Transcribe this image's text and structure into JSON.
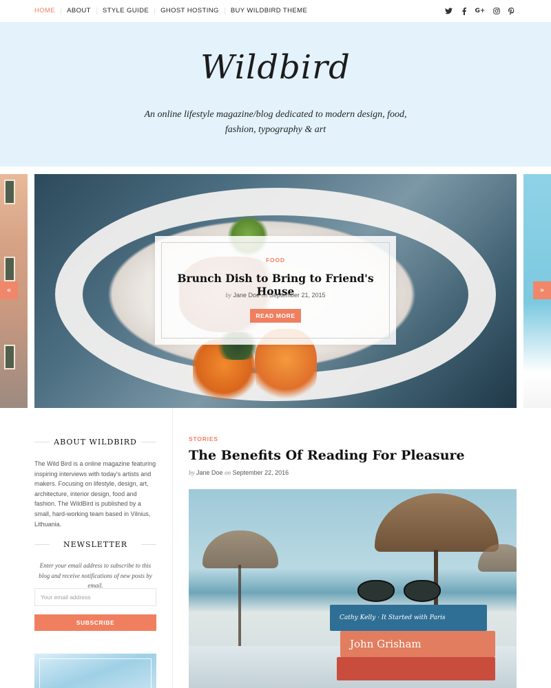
{
  "nav": {
    "items": [
      "Home",
      "About",
      "Style Guide",
      "Ghost Hosting",
      "Buy WildBird Theme"
    ],
    "active_index": 0
  },
  "socials": [
    "twitter-icon",
    "facebook-icon",
    "google-plus-icon",
    "instagram-icon",
    "pinterest-icon"
  ],
  "header": {
    "logo": "Wildbird",
    "tagline": "An online lifestyle magazine/blog dedicated to modern design, food, fashion, typography & art"
  },
  "slider": {
    "category": "Food",
    "title": "Brunch Dish to Bring to Friend's House",
    "by": "by",
    "author": "Jane Doe",
    "on": "on",
    "date": "September 21, 2015",
    "button": "Read More",
    "prev_icon": "«",
    "next_icon": "»"
  },
  "sidebar": {
    "about_title": "About Wildbird",
    "about_text": "The Wild Bird is a online magazine featuring inspiring interviews with today's artists and makers. Focusing on lifestyle, design, art, architecture, interior design, food and fashion. The WildBird is published by a small, hard-working team based in Vilnius, Lithuania.",
    "newsletter_title": "Newsletter",
    "newsletter_text": "Enter your email address to subscribe to this blog and receive notifications of new posts by email.",
    "email_placeholder": "Your email address",
    "subscribe_label": "Subscribe"
  },
  "post": {
    "category": "Stories",
    "title": "The Benefits Of Reading For Pleasure",
    "by": "by",
    "author": "Jane Doe",
    "on": "on",
    "date": "September 22, 2016",
    "book_1": "Cathy Kelly · It Started with Paris",
    "book_2": "John Grisham"
  },
  "colors": {
    "accent": "#f07f60",
    "header_bg": "#e3f2fb"
  }
}
